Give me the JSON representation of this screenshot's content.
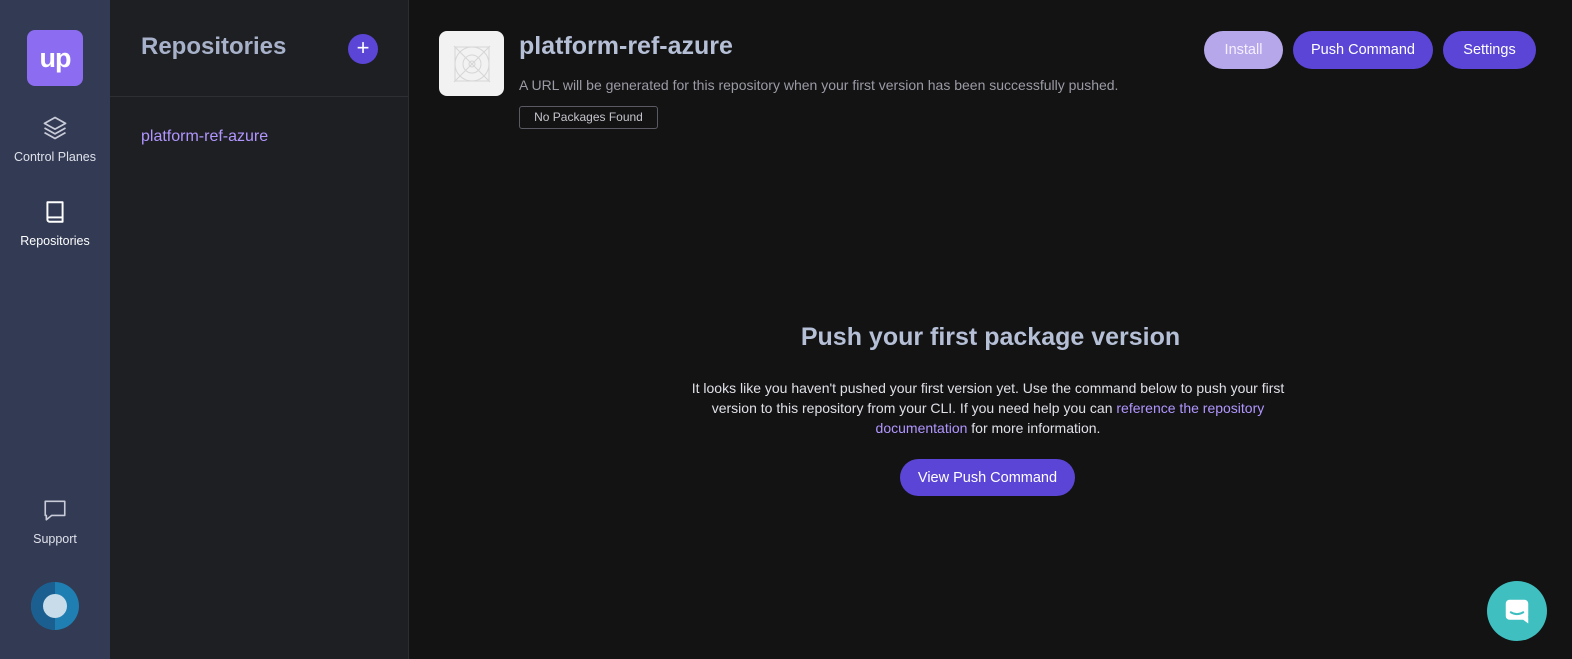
{
  "rail": {
    "logo_text": "up",
    "items": [
      {
        "label": "Control Planes",
        "icon": "layers-icon"
      },
      {
        "label": "Repositories",
        "icon": "book-icon"
      },
      {
        "label": "Support",
        "icon": "chat-bubble-icon"
      }
    ],
    "avatar_icon": "avatar-icon"
  },
  "repo_panel": {
    "title": "Repositories",
    "add_label": "+",
    "repos": [
      "platform-ref-azure"
    ]
  },
  "main": {
    "title": "platform-ref-azure",
    "subtitle": "A URL will be generated for this repository when your first version has been successfully pushed.",
    "badge": "No Packages Found",
    "buttons": {
      "install": "Install",
      "push": "Push Command",
      "settings": "Settings"
    },
    "empty": {
      "title": "Push your first package version",
      "text_before": "It looks like you haven't pushed your first version yet. Use the command below to push your first version to this repository from your CLI. If you need help you can ",
      "link": "reference the repository documentation",
      "text_after": " for more information.",
      "button": "View Push Command"
    }
  },
  "colors": {
    "accent": "#5b45d6",
    "accent_light": "#b6a6ea",
    "link": "#b196ff",
    "rail_bg": "#323a54",
    "chat": "#3fbfc0"
  }
}
